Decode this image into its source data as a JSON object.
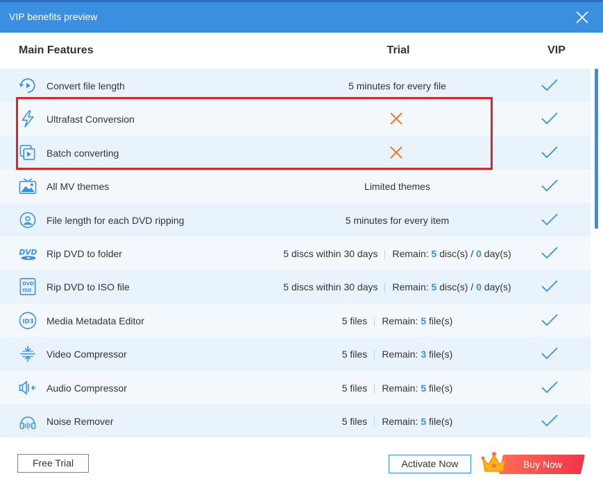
{
  "dialog": {
    "title": "VIP benefits preview",
    "colors": {
      "accent": "#3a8fe0",
      "title_bar": "#3a8fe0",
      "highlight_border": "#d9262c",
      "cross": "#f07b2b",
      "buy_button": "#f0364a"
    }
  },
  "header": {
    "main": "Main Features",
    "trial": "Trial",
    "vip": "VIP"
  },
  "rows": [
    {
      "icon": "convert-length-icon",
      "name": "Convert file length",
      "trial": "5 minutes for every file"
    },
    {
      "icon": "lightning-icon",
      "name": "Ultrafast Conversion",
      "trial_icon": "cross-icon"
    },
    {
      "icon": "batch-convert-icon",
      "name": "Batch converting",
      "trial_icon": "cross-icon"
    },
    {
      "icon": "mv-theme-icon",
      "name": "All MV themes",
      "trial": "Limited themes"
    },
    {
      "icon": "dvd-ripping-icon",
      "name": "File length for each DVD ripping",
      "trial": "5 minutes for every item"
    },
    {
      "icon": "dvd-icon",
      "name": "Rip DVD to folder",
      "trial_left": "5 discs within 30 days",
      "remain_label": "Remain:",
      "remain_a": "5",
      "remain_a_unit": "disc(s) /",
      "remain_b": "0",
      "remain_b_unit": "day(s)"
    },
    {
      "icon": "iso-icon",
      "name": "Rip DVD to ISO file",
      "trial_left": "5 discs within 30 days",
      "remain_label": "Remain:",
      "remain_a": "5",
      "remain_a_unit": "disc(s) /",
      "remain_b": "0",
      "remain_b_unit": "day(s)"
    },
    {
      "icon": "id3-icon",
      "name": "Media Metadata Editor",
      "trial_left": "5 files",
      "remain_label": "Remain:",
      "remain_a": "5",
      "remain_a_unit": "file(s)"
    },
    {
      "icon": "video-compressor-icon",
      "name": "Video Compressor",
      "trial_left": "5 files",
      "remain_label": "Remain:",
      "remain_a": "3",
      "remain_a_unit": "file(s)"
    },
    {
      "icon": "audio-compressor-icon",
      "name": "Audio Compressor",
      "trial_left": "5 files",
      "remain_label": "Remain:",
      "remain_a": "5",
      "remain_a_unit": "file(s)"
    },
    {
      "icon": "noise-remover-icon",
      "name": "Noise Remover",
      "trial_left": "5 files",
      "remain_label": "Remain:",
      "remain_a": "5",
      "remain_a_unit": "file(s)"
    }
  ],
  "footer": {
    "free_trial": "Free Trial",
    "activate_now": "Activate Now",
    "buy_now": "Buy Now"
  }
}
